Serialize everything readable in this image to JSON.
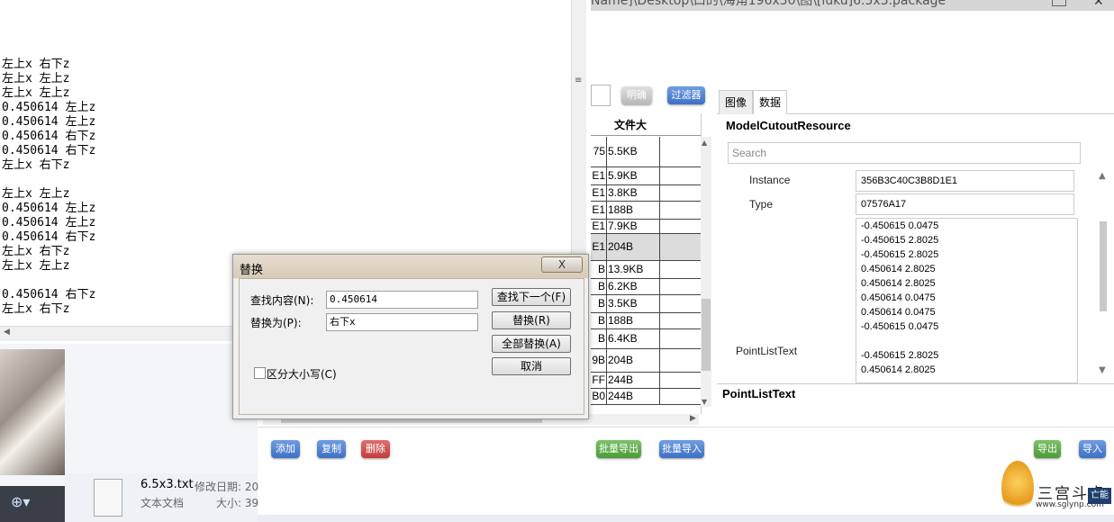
{
  "app": {
    "title_fragment": "Name]\\Desktop\\口的\\海角196x30\\图\\[luku]6.5x3.package",
    "clear_button": "明确",
    "filter_button": "过滤器",
    "table": {
      "header": "文件大",
      "rows": [
        {
          "a": "75",
          "b": "5.5KB"
        },
        {
          "a": "E1",
          "b": "5.9KB"
        },
        {
          "a": "E1",
          "b": "3.8KB"
        },
        {
          "a": "E1",
          "b": "188B"
        },
        {
          "a": "E1",
          "b": "7.9KB"
        },
        {
          "a": "E1",
          "b": "204B"
        },
        {
          "a": "B",
          "b": "13.9KB"
        },
        {
          "a": "B",
          "b": "6.2KB"
        },
        {
          "a": "B",
          "b": "3.5KB"
        },
        {
          "a": "B",
          "b": "188B"
        },
        {
          "a": "B",
          "b": "6.4KB"
        },
        {
          "a": "9B",
          "b": "204B"
        },
        {
          "a": "FF",
          "b": "244B"
        },
        {
          "a": "B0",
          "b": "244B"
        }
      ]
    },
    "tabs": [
      "图像",
      "数据"
    ],
    "resource_title": "ModelCutoutResource",
    "search_placeholder": "Search",
    "props": {
      "instance_label": "Instance",
      "instance_value": "356B3C40C3B8D1E1",
      "type_label": "Type",
      "type_value": "07576A17",
      "pointlist_label": "PointListText",
      "pointlist_values": [
        "-0.450615 0.0475",
        "-0.450615 2.8025",
        "-0.450615 2.8025",
        "0.450614 2.8025",
        "0.450614 2.8025",
        "0.450614 0.0475",
        "0.450614 0.0475",
        "-0.450615 0.0475",
        "",
        "-0.450615 2.8025",
        "0.450614 2.8025"
      ]
    },
    "description_title": "PointListText",
    "bottom_buttons": {
      "add": "添加",
      "copy": "复制",
      "delete": "删除",
      "batch_export": "批量导出",
      "batch_import": "批量导入",
      "export": "导出",
      "import": "导入"
    }
  },
  "notepad": {
    "lines": [
      "",
      "",
      "",
      "",
      "左上x 右下z",
      "左上x 左上z",
      "左上x 左上z",
      "0.450614 左上z",
      "0.450614 左上z",
      "0.450614 右下z",
      "0.450614 右下z",
      "左上x 右下z",
      "",
      "左上x 左上z",
      "0.450614 左上z",
      "0.450614 左上z",
      "0.450614 右下z",
      "左上x 右下z",
      "左上x 左上z",
      "",
      "0.450614 右下z",
      "左上x 右下z"
    ]
  },
  "explorer": {
    "file_name": "6.5x3.txt",
    "modified_label": "修改日期: 20",
    "file_type": "文本文档",
    "size_label": "大小: 39"
  },
  "dialog": {
    "title": "替换",
    "close_label": "X",
    "find_label": "查找内容(N):",
    "find_value": "0.450614",
    "replace_label": "替换为(P):",
    "replace_value": "右下x",
    "find_next": "查找下一个(F)",
    "replace": "替换(R)",
    "replace_all": "全部替换(A)",
    "cancel": "取消",
    "match_case": "区分大小写(C)"
  },
  "watermark": {
    "text": "三宫斗虎",
    "url": "www.sglynp.com",
    "corner_label": "亡能"
  }
}
